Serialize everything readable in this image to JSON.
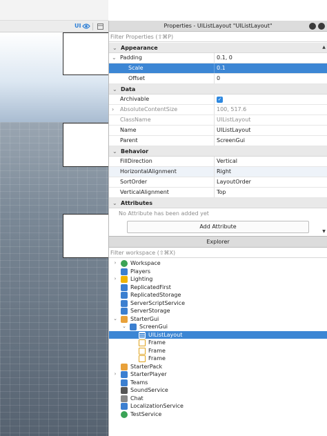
{
  "viewport": {
    "toolbar_ui_label": "UI",
    "toolbar_icons": [
      "eye-icon",
      "frame-icon"
    ]
  },
  "properties": {
    "title": "Properties - UIListLayout \"UIListLayout\"",
    "filter_placeholder": "Filter Properties (⇧⌘P)",
    "sections": {
      "appearance": "Appearance",
      "data": "Data",
      "behavior": "Behavior",
      "attributes": "Attributes"
    },
    "rows": {
      "padding": {
        "name": "Padding",
        "value": "0.1, 0"
      },
      "scale": {
        "name": "Scale",
        "value": "0.1"
      },
      "offset": {
        "name": "Offset",
        "value": "0"
      },
      "archivable": {
        "name": "Archivable",
        "value": true
      },
      "abs_content_size": {
        "name": "AbsoluteContentSize",
        "value": "100, 517.6"
      },
      "class_name": {
        "name": "ClassName",
        "value": "UIListLayout"
      },
      "name": {
        "name": "Name",
        "value": "UIListLayout"
      },
      "parent": {
        "name": "Parent",
        "value": "ScreenGui"
      },
      "fill_direction": {
        "name": "FillDirection",
        "value": "Vertical"
      },
      "horizontal_alignment": {
        "name": "HorizontalAlignment",
        "value": "Right"
      },
      "sort_order": {
        "name": "SortOrder",
        "value": "LayoutOrder"
      },
      "vertical_alignment": {
        "name": "VerticalAlignment",
        "value": "Top"
      }
    },
    "attributes_empty": "No Attribute has been added yet",
    "add_attribute_label": "Add Attribute"
  },
  "explorer": {
    "title": "Explorer",
    "filter_placeholder": "Filter workspace (⇧⌘X)",
    "items": [
      {
        "label": "Workspace",
        "icon": "globe-icon",
        "color": "#3aa356",
        "depth": 0,
        "expander": "›"
      },
      {
        "label": "Players",
        "icon": "players-icon",
        "color": "#3b7fd0",
        "depth": 0,
        "expander": ""
      },
      {
        "label": "Lighting",
        "icon": "lightbulb-icon",
        "color": "#f0b400",
        "depth": 0,
        "expander": "›"
      },
      {
        "label": "ReplicatedFirst",
        "icon": "replicated-first-icon",
        "color": "#3b7fd0",
        "depth": 0,
        "expander": ""
      },
      {
        "label": "ReplicatedStorage",
        "icon": "replicated-storage-icon",
        "color": "#3b7fd0",
        "depth": 0,
        "expander": ""
      },
      {
        "label": "ServerScriptService",
        "icon": "server-script-service-icon",
        "color": "#3b7fd0",
        "depth": 0,
        "expander": ""
      },
      {
        "label": "ServerStorage",
        "icon": "server-storage-icon",
        "color": "#3b7fd0",
        "depth": 0,
        "expander": ""
      },
      {
        "label": "StarterGui",
        "icon": "starter-gui-icon",
        "color": "#e8a13a",
        "depth": 0,
        "expander": "⌄"
      },
      {
        "label": "ScreenGui",
        "icon": "screen-gui-icon",
        "color": "#3b7fd0",
        "depth": 1,
        "expander": "⌄"
      },
      {
        "label": "UIListLayout",
        "icon": "list-layout-icon",
        "color": "#ffffff",
        "depth": 2,
        "expander": "",
        "selected": true
      },
      {
        "label": "Frame",
        "icon": "frame-icon",
        "color": "#e0a21a",
        "depth": 2,
        "expander": ""
      },
      {
        "label": "Frame",
        "icon": "frame-icon",
        "color": "#e0a21a",
        "depth": 2,
        "expander": ""
      },
      {
        "label": "Frame",
        "icon": "frame-icon",
        "color": "#e0a21a",
        "depth": 2,
        "expander": ""
      },
      {
        "label": "StarterPack",
        "icon": "starter-pack-icon",
        "color": "#e8a13a",
        "depth": 0,
        "expander": ""
      },
      {
        "label": "StarterPlayer",
        "icon": "starter-player-icon",
        "color": "#3b7fd0",
        "depth": 0,
        "expander": "›"
      },
      {
        "label": "Teams",
        "icon": "teams-icon",
        "color": "#3b7fd0",
        "depth": 0,
        "expander": ""
      },
      {
        "label": "SoundService",
        "icon": "speaker-icon",
        "color": "#555555",
        "depth": 0,
        "expander": ""
      },
      {
        "label": "Chat",
        "icon": "chat-icon",
        "color": "#888888",
        "depth": 0,
        "expander": ""
      },
      {
        "label": "LocalizationService",
        "icon": "localization-icon",
        "color": "#3b7fd0",
        "depth": 0,
        "expander": ""
      },
      {
        "label": "TestService",
        "icon": "test-service-icon",
        "color": "#3aa356",
        "depth": 0,
        "expander": ""
      }
    ]
  },
  "colors": {
    "selection": "#3c86d4",
    "checkbox": "#2d88e0",
    "accent_ui": "#2d7fd6"
  }
}
